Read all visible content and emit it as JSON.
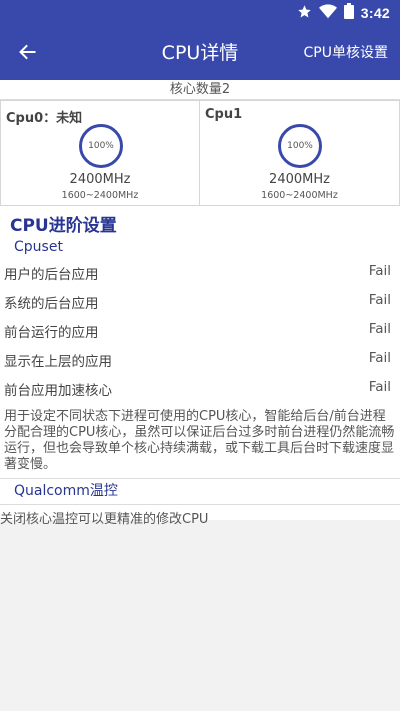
{
  "statusbar": {
    "time": "3:42",
    "icons": [
      "star-icon",
      "wifi-icon",
      "battery-icon"
    ]
  },
  "appbar": {
    "title": "CPU详情",
    "action": "CPU单核设置"
  },
  "cores": {
    "count_label": "核心数量2",
    "items": [
      {
        "name": "Cpu0：未知",
        "load": "100%",
        "freq": "2400MHz",
        "range": "1600~2400MHz"
      },
      {
        "name": "Cpu1",
        "load": "100%",
        "freq": "2400MHz",
        "range": "1600~2400MHz"
      }
    ]
  },
  "advanced": {
    "title": "CPU进阶设置",
    "cpuset_title": "Cpuset",
    "rows": [
      {
        "label": "用户的后台应用",
        "value": "Fail"
      },
      {
        "label": "系统的后台应用",
        "value": "Fail"
      },
      {
        "label": "前台运行的应用",
        "value": "Fail"
      },
      {
        "label": "显示在上层的应用",
        "value": "Fail"
      },
      {
        "label": "前台应用加速核心",
        "value": "Fail"
      }
    ],
    "description": "用于设定不同状态下进程可使用的CPU核心，智能给后台/前台进程分配合理的CPU核心，虽然可以保证后台过多时前台进程仍然能流畅运行，但也会导致单个核心持续满载，或下载工具后台时下载速度显著变慢。",
    "qualcomm_title": "Qualcomm温控",
    "qualcomm_desc": "关闭核心温控可以更精准的修改CPU"
  },
  "colors": {
    "primary": "#3949ab",
    "accent": "#283593",
    "ring": "#3949ab"
  }
}
